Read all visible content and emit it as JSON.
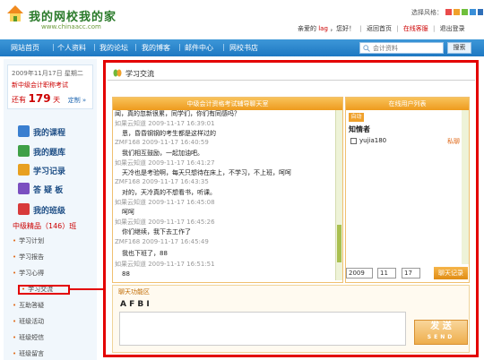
{
  "header": {
    "site_title": "我的网校我的家",
    "site_url": "www.chinaacc.com",
    "style_label": "选择风格：",
    "style_colors": [
      "#e94b4b",
      "#f0a12b",
      "#6fbf3b",
      "#3a8fd8",
      "#2f6fb8"
    ],
    "greeting_prefix": "亲爱的",
    "username": "lag",
    "greeting_suffix": "，您好！",
    "back_home": "返回首页",
    "online_service": "在线客服",
    "logout": "退出登录"
  },
  "nav": {
    "items": [
      "网站首页",
      "个人资料",
      "我的论坛",
      "我的博客",
      "邮件中心",
      "网校书店"
    ],
    "search_placeholder": "会计资料",
    "search_button": "搜索"
  },
  "sidebar": {
    "date": "2009年11月17日 星期二",
    "exam_name": "新中级会计职称考试",
    "countdown_prefix": "还有",
    "countdown_days": "179",
    "countdown_unit": "天",
    "countdown_set": "定制 »",
    "menu": [
      {
        "label": "我的课程",
        "icon": "course-icon",
        "color": "#3a7fd0"
      },
      {
        "label": "我的题库",
        "icon": "question-bank-icon",
        "color": "#3fa046"
      },
      {
        "label": "学习记录",
        "icon": "study-record-icon",
        "color": "#e8a020"
      },
      {
        "label": "答 疑 板",
        "icon": "qa-board-icon",
        "color": "#7a4fc0"
      },
      {
        "label": "我的班级",
        "icon": "my-class-icon",
        "color": "#d83a3a"
      }
    ],
    "class_title": "中级精品（146）班",
    "sub_items": [
      "学习计划",
      "学习报告",
      "学习心得",
      "学习交流",
      "互助答疑",
      "班级活动",
      "班级短信",
      "班级留言"
    ]
  },
  "main": {
    "title": "学习交流",
    "chat_header": "中级会计资格考试辅导聊天室",
    "online_header": "在线用户列表",
    "messages": [
      {
        "type": "text",
        "text": "闻，真的忽新很累，同学们，你们有同感吗？"
      },
      {
        "type": "head",
        "text": "如果云知道  2009-11-17 16:39:01"
      },
      {
        "type": "text",
        "text": "恩，昏昏钢钢的考生都是这样过的"
      },
      {
        "type": "head",
        "text": "ZMF168  2009-11-17 16:40:59"
      },
      {
        "type": "text",
        "text": "我们相互鼓励，一起加油吧。"
      },
      {
        "type": "head",
        "text": "如果云知道  2009-11-17 16:41:27"
      },
      {
        "type": "text",
        "text": "天冷也是考验啊，每天只想待在床上，不学习，不上班，呵呵"
      },
      {
        "type": "head",
        "text": "ZMF168  2009-11-17 16:43:35"
      },
      {
        "type": "text",
        "text": "对的，天冷真的不想看书，听课。"
      },
      {
        "type": "head",
        "text": "如果云知道  2009-11-17 16:45:08"
      },
      {
        "type": "text",
        "text": "呵呵"
      },
      {
        "type": "head",
        "text": "如果云知道  2009-11-17 16:45:26"
      },
      {
        "type": "text",
        "text": "你们继续，我下去工作了"
      },
      {
        "type": "head",
        "text": "ZMF168  2009-11-17 16:45:49"
      },
      {
        "type": "text",
        "text": "我也下班了，88"
      },
      {
        "type": "head",
        "text": "如果云知道  2009-11-17 16:51:51"
      },
      {
        "type": "text",
        "text": "88"
      }
    ],
    "online_tab": "自动",
    "online_group": "知情者",
    "online_user": "yujia180",
    "online_action": "私聊",
    "date_selects": [
      "2009",
      "11",
      "17"
    ],
    "refresh_button": "聊天记录",
    "input_area_title": "聊天功能区",
    "toolbar": "A  F  B  I",
    "send_button": "发 送",
    "send_button_en": "SEND"
  }
}
